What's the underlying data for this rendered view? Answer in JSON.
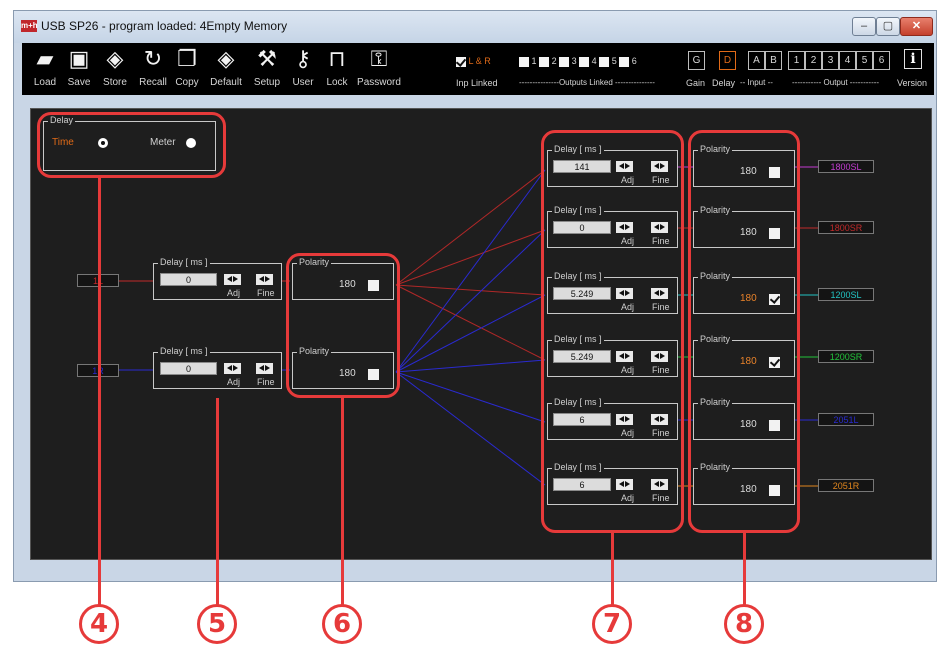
{
  "window": {
    "title": "USB  SP26  - program loaded: 4Empty Memory",
    "app_icon_text": "m+h"
  },
  "toolbar": {
    "items": [
      {
        "label": "Load",
        "icon": "folder-icon"
      },
      {
        "label": "Save",
        "icon": "floppy-icon"
      },
      {
        "label": "Store",
        "icon": "chip-icon"
      },
      {
        "label": "Recall",
        "icon": "refresh-icon"
      },
      {
        "label": "Copy",
        "icon": "copy-icon"
      },
      {
        "label": "Default",
        "icon": "chip-icon"
      },
      {
        "label": "Setup",
        "icon": "wrench-icon"
      },
      {
        "label": "User",
        "icon": "user-key-icon"
      },
      {
        "label": "Lock",
        "icon": "lock-icon"
      },
      {
        "label": "Password",
        "icon": "key-icon"
      }
    ],
    "inp_linked": {
      "checkbox_label": "L & R",
      "label": "Inp Linked",
      "checked": true
    },
    "outputs_linked": {
      "numbers": [
        "1",
        "2",
        "3",
        "4",
        "5",
        "6"
      ],
      "label": "---------------Outputs Linked ---------------"
    },
    "gain_label": "Gain",
    "gain_btn": "G",
    "delay_label": "Delay",
    "delay_btn": "D",
    "input_label": "-- Input --",
    "input_btns": [
      "A",
      "B"
    ],
    "output_label": "----------- Output -----------",
    "output_btns": [
      "1",
      "2",
      "3",
      "4",
      "5",
      "6"
    ],
    "version_label": "Version",
    "version_icon": "i"
  },
  "delay_mode": {
    "title": "Delay",
    "time_label": "Time",
    "meter_label": "Meter",
    "selected": "Time"
  },
  "inputs": [
    {
      "name": "1L",
      "color": "#c02a2a",
      "delay_title": "Delay [ ms ]",
      "delay": "0",
      "adj": "Adj",
      "fine": "Fine",
      "polarity_title": "Polarity",
      "polarity": "180",
      "inverted": false
    },
    {
      "name": "1R",
      "color": "#2a2ad0",
      "delay_title": "Delay [ ms ]",
      "delay": "0",
      "adj": "Adj",
      "fine": "Fine",
      "polarity_title": "Polarity",
      "polarity": "180",
      "inverted": false
    }
  ],
  "outputs": [
    {
      "name": "1800SL",
      "color": "#c23bd0",
      "delay_title": "Delay [ ms ]",
      "delay": "141",
      "adj": "Adj",
      "fine": "Fine",
      "polarity_title": "Polarity",
      "polarity": "180",
      "inverted": false
    },
    {
      "name": "1800SR",
      "color": "#c02a2a",
      "delay_title": "Delay [ ms ]",
      "delay": "0",
      "adj": "Adj",
      "fine": "Fine",
      "polarity_title": "Polarity",
      "polarity": "180",
      "inverted": false
    },
    {
      "name": "1200SL",
      "color": "#22c3c3",
      "delay_title": "Delay [ ms ]",
      "delay": "5.249",
      "adj": "Adj",
      "fine": "Fine",
      "polarity_title": "Polarity",
      "polarity": "180",
      "inverted": true
    },
    {
      "name": "1200SR",
      "color": "#22c23a",
      "delay_title": "Delay [ ms ]",
      "delay": "5.249",
      "adj": "Adj",
      "fine": "Fine",
      "polarity_title": "Polarity",
      "polarity": "180",
      "inverted": true
    },
    {
      "name": "2051L",
      "color": "#2a2ad0",
      "delay_title": "Delay [ ms ]",
      "delay": "6",
      "adj": "Adj",
      "fine": "Fine",
      "polarity_title": "Polarity",
      "polarity": "180",
      "inverted": false
    },
    {
      "name": "2051R",
      "color": "#e0861e",
      "delay_title": "Delay [ ms ]",
      "delay": "6",
      "adj": "Adj",
      "fine": "Fine",
      "polarity_title": "Polarity",
      "polarity": "180",
      "inverted": false
    }
  ],
  "callouts": [
    "4",
    "5",
    "6",
    "7",
    "8"
  ],
  "colors": {
    "highlight": "#e63a3a",
    "accent_orange": "#e06a18",
    "panel_bg": "#1e1e1e"
  }
}
